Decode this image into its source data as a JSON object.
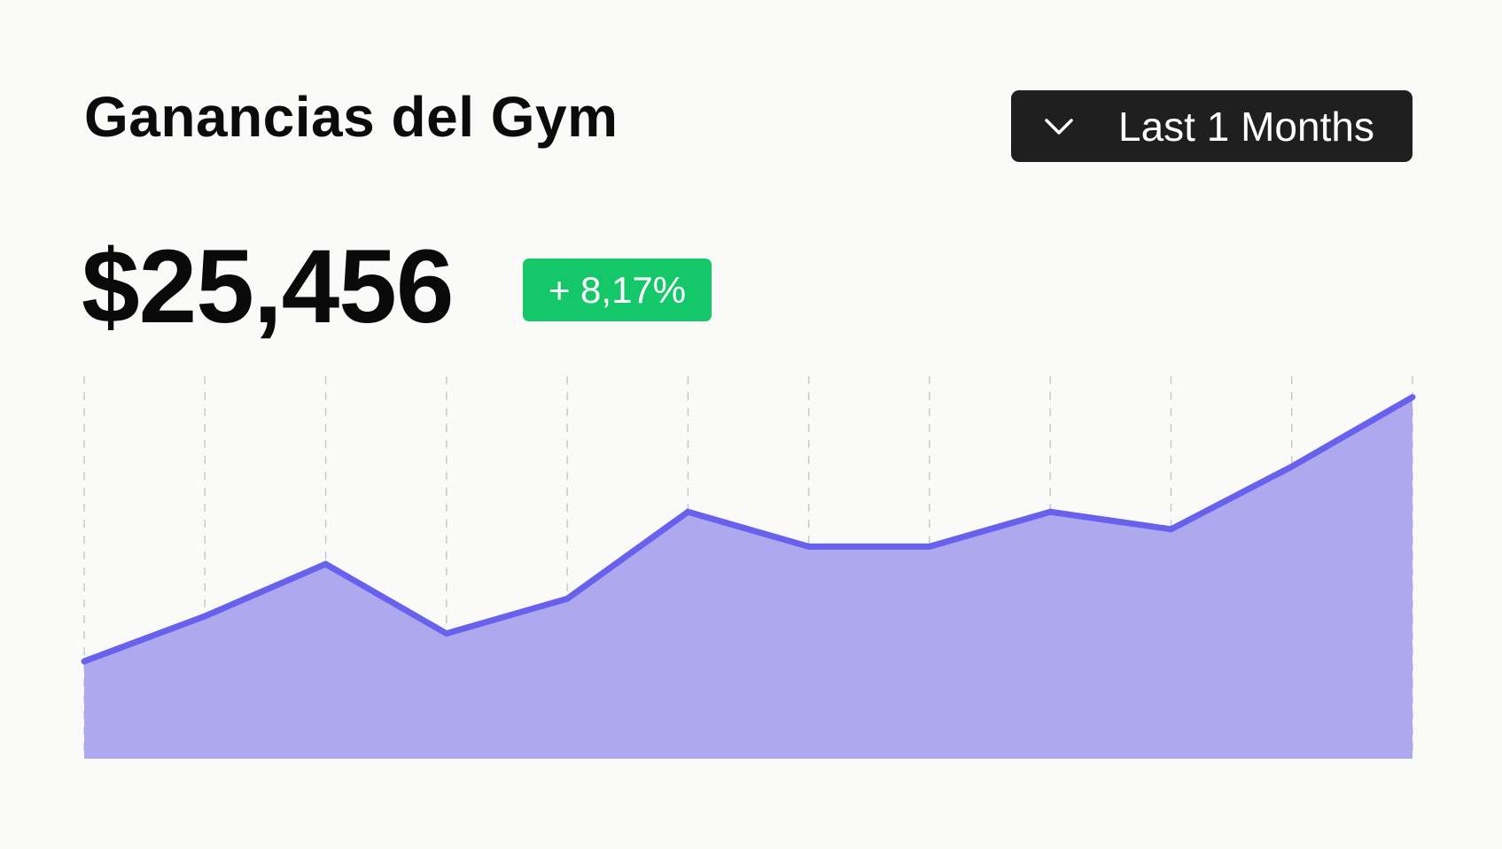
{
  "header": {
    "title": "Ganancias del Gym",
    "range_select": {
      "label": "Last 1 Months",
      "icon": "chevron-down-icon"
    }
  },
  "summary": {
    "value": "$25,456",
    "change": "+ 8,17%"
  },
  "colors": {
    "background": "#fafaf8",
    "line": "#6761ee",
    "area": "#aea8ef",
    "badge": "#14c768",
    "select_bg": "#1f1f1f",
    "grid": "#c9c9c9"
  },
  "chart_data": {
    "type": "area",
    "x": [
      1,
      2,
      3,
      4,
      5,
      6,
      7,
      8,
      9,
      10,
      11,
      12
    ],
    "series": [
      {
        "values": [
          2.8,
          4.1,
          5.6,
          3.6,
          4.6,
          7.1,
          6.1,
          6.1,
          7.1,
          6.6,
          8.4,
          10.4
        ]
      }
    ],
    "ylim": [
      0,
      11.0
    ],
    "grid": "vertical dashed",
    "legend": "none",
    "axes_labels_shown": false
  }
}
